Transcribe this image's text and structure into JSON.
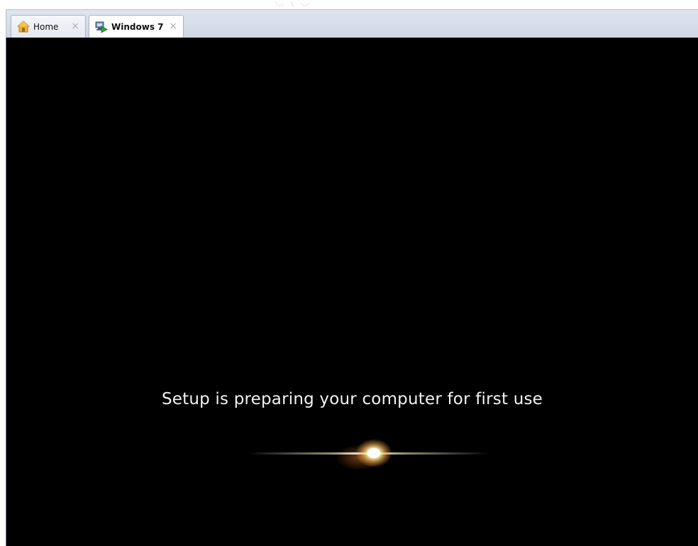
{
  "tabs": [
    {
      "label": "Home",
      "icon": "home-icon",
      "active": false
    },
    {
      "label": "Windows 7",
      "icon": "vm-running-icon",
      "active": true
    }
  ],
  "close_glyph": "×",
  "screen": {
    "message": "Setup is preparing your computer for first use",
    "background": "#000000",
    "text_color": "#f2f2f2"
  },
  "colors": {
    "tabbar": "#d6dce8",
    "glow_core": "#fff4c0",
    "glow_warm": "#e8a040"
  }
}
